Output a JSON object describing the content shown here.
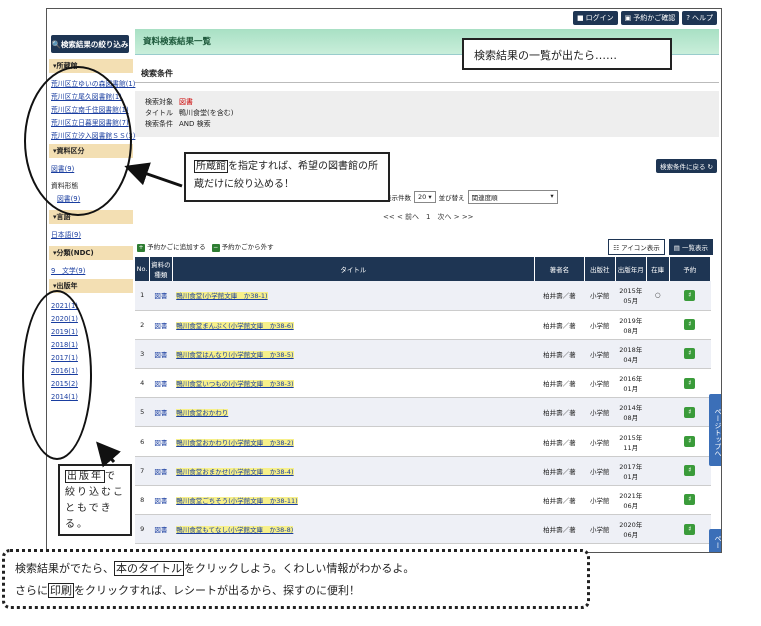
{
  "topbar": {
    "login": "ログイン",
    "cart": "予約かご確認",
    "help": "ヘルプ"
  },
  "sidebar": {
    "header": "検索結果の絞り込み",
    "library_section": "所蔵館",
    "libraries": [
      "荒川区立ゆいの森図書館(1)",
      "荒川区立尾久図書館(1)",
      "荒川区立南千住図書館(1)",
      "荒川区立日暮里図書館(7)",
      "荒川区立汐入図書館ＳＳ(3)"
    ],
    "material_section": "資料区分",
    "material_item": "図書(9)",
    "form_label": "資料形態",
    "form_item": "図書(9)",
    "language_section": "言語",
    "language_item": "日本語(9)",
    "ndc_section": "分類(NDC)",
    "ndc_item": "9　文学(9)",
    "year_section": "出版年",
    "years": [
      "2021(1)",
      "2020(1)",
      "2019(1)",
      "2018(1)",
      "2017(1)",
      "2016(1)",
      "2015(2)",
      "2014(1)"
    ]
  },
  "main": {
    "title": "資料検索結果一覧",
    "conditions_head": "検索条件",
    "conditions": [
      {
        "key": "検索対象",
        "value": "図書"
      },
      {
        "key": "タイトル",
        "value": "鴨川食堂(を含む)"
      },
      {
        "key": "検索条件",
        "value": "AND 検索"
      }
    ],
    "back_to_conditions": "検索条件に戻る",
    "per_page_label": "表示件数",
    "per_page_value": "20",
    "sort_label": "並び替え",
    "sort_value": "関連度順",
    "pager": "<< < 前へ　1　次へ > >>",
    "add_to_cart": "予約かごに追加する",
    "remove_from_cart": "予約かごから外す",
    "icon_view": "アイコン表示",
    "list_view": "一覧表示",
    "columns": [
      "No.",
      "資料の種類",
      "タイトル",
      "著者名",
      "出版社",
      "出版年月",
      "在庫",
      "予約"
    ],
    "rows": [
      {
        "no": "1",
        "type": "図書",
        "title": "鴨川食堂(小学館文庫　か38-1)",
        "author": "柏井壽／著",
        "publisher": "小学館",
        "date": "2015年05月",
        "stock": "○"
      },
      {
        "no": "2",
        "type": "図書",
        "title": "鴨川食堂まんぷく(小学館文庫　か38-6)",
        "author": "柏井壽／著",
        "publisher": "小学館",
        "date": "2019年08月",
        "stock": ""
      },
      {
        "no": "3",
        "type": "図書",
        "title": "鴨川食堂はんなり(小学館文庫　か38-5)",
        "author": "柏井壽／著",
        "publisher": "小学館",
        "date": "2018年04月",
        "stock": ""
      },
      {
        "no": "4",
        "type": "図書",
        "title": "鴨川食堂いつもの(小学館文庫　か38-3)",
        "author": "柏井壽／著",
        "publisher": "小学館",
        "date": "2016年01月",
        "stock": ""
      },
      {
        "no": "5",
        "type": "図書",
        "title": "鴨川食堂おかわり",
        "author": "柏井壽／著",
        "publisher": "小学館",
        "date": "2014年08月",
        "stock": ""
      },
      {
        "no": "6",
        "type": "図書",
        "title": "鴨川食堂おかわり(小学館文庫　か38-2)",
        "author": "柏井壽／著",
        "publisher": "小学館",
        "date": "2015年11月",
        "stock": ""
      },
      {
        "no": "7",
        "type": "図書",
        "title": "鴨川食堂おまかせ(小学館文庫　か38-4)",
        "author": "柏井壽／著",
        "publisher": "小学館",
        "date": "2017年01月",
        "stock": ""
      },
      {
        "no": "8",
        "type": "図書",
        "title": "鴨川食堂ごちそう(小学館文庫　か38-11)",
        "author": "柏井壽／著",
        "publisher": "小学館",
        "date": "2021年06月",
        "stock": ""
      },
      {
        "no": "9",
        "type": "図書",
        "title": "鴨川食堂もてなし(小学館文庫　か38-8)",
        "author": "柏井壽／著",
        "publisher": "小学館",
        "date": "2020年06月",
        "stock": ""
      }
    ],
    "page_top": "ページトップへ",
    "page_top2": "ペー"
  },
  "callouts": {
    "results": "検索結果の一覧が出たら……",
    "library_pre": "所蔵館",
    "library_post": "を指定すれば、希望の図書館の所蔵だけに絞り込める！",
    "year_pre": "出版年",
    "year_post": "で絞り込むこともできる。",
    "note_line1_a": "検索結果がでたら、",
    "note_line1_b": "本のタイトル",
    "note_line1_c": "をクリックしよう。くわしい情報がわかるよ。",
    "note_line2_a": "さらに",
    "note_line2_b": "印刷",
    "note_line2_c": "をクリックすれば、レシートが出るから、探すのに便利！"
  },
  "colors": {
    "navy": "#1e3553",
    "mint": "#a8e0c4",
    "section": "#f3dfb3",
    "link": "#1a3ea0"
  }
}
